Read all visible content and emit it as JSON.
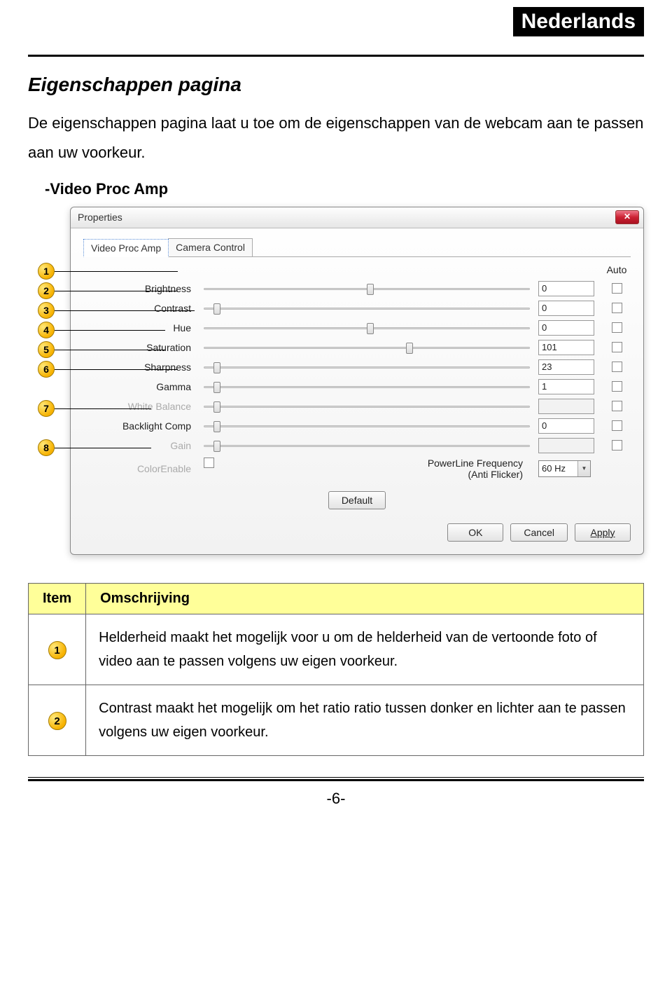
{
  "header": {
    "language": "Nederlands"
  },
  "page": {
    "title": "Eigenschappen pagina",
    "intro": "De eigenschappen pagina laat u toe om de eigenschappen van de webcam aan te passen aan uw voorkeur.",
    "subheading": "-Video Proc Amp"
  },
  "dialog": {
    "title": "Properties",
    "tabs": {
      "active": "Video Proc Amp",
      "inactive": "Camera Control"
    },
    "headers": {
      "auto": "Auto"
    },
    "rows": [
      {
        "label": "Brightness",
        "value": "0",
        "pos": 50,
        "enabled": true
      },
      {
        "label": "Contrast",
        "value": "0",
        "pos": 3,
        "enabled": true
      },
      {
        "label": "Hue",
        "value": "0",
        "pos": 50,
        "enabled": true
      },
      {
        "label": "Saturation",
        "value": "101",
        "pos": 62,
        "enabled": true
      },
      {
        "label": "Sharpness",
        "value": "23",
        "pos": 3,
        "enabled": true
      },
      {
        "label": "Gamma",
        "value": "1",
        "pos": 3,
        "enabled": true
      },
      {
        "label": "White Balance",
        "value": "",
        "pos": 3,
        "enabled": false
      },
      {
        "label": "Backlight Comp",
        "value": "0",
        "pos": 3,
        "enabled": true
      },
      {
        "label": "Gain",
        "value": "",
        "pos": 3,
        "enabled": false
      }
    ],
    "colorEnable": "ColorEnable",
    "powerline": {
      "label": "PowerLine Frequency",
      "sub": "(Anti Flicker)",
      "value": "60 Hz"
    },
    "buttons": {
      "default": "Default",
      "ok": "OK",
      "cancel": "Cancel",
      "apply": "Apply"
    }
  },
  "callouts": [
    "1",
    "2",
    "3",
    "4",
    "5",
    "6",
    "7",
    "8"
  ],
  "table": {
    "headers": {
      "item": "Item",
      "desc": "Omschrijving"
    },
    "rows": [
      {
        "num": "1",
        "text": "Helderheid maakt het mogelijk voor u om de helderheid van de vertoonde foto of video aan te passen volgens uw eigen voorkeur."
      },
      {
        "num": "2",
        "text": "Contrast maakt het mogelijk om het ratio ratio tussen donker en lichter aan te passen volgens uw eigen voorkeur."
      }
    ]
  },
  "footer": {
    "pagenum": "-6-"
  }
}
